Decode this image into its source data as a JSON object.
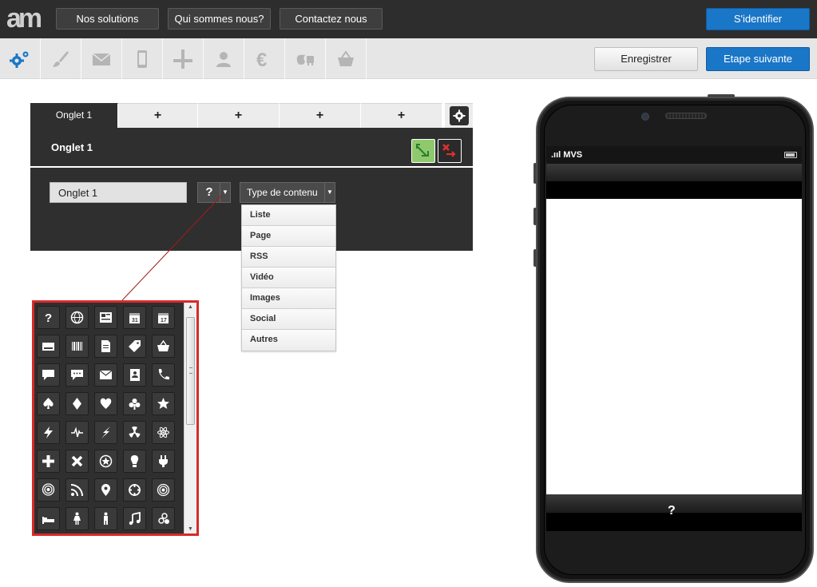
{
  "header": {
    "logo_text": "am",
    "nav": [
      "Nos solutions",
      "Qui sommes nous?",
      "Contactez nous"
    ],
    "login_label": "S'identifier"
  },
  "toolbar": {
    "tools": [
      "gears-icon",
      "brush-icon",
      "envelope-icon",
      "smartphone-icon",
      "layout-cross-icon",
      "user-icon",
      "euro-icon",
      "apple-android-icon",
      "basket-icon"
    ],
    "register_label": "Enregistrer",
    "next_label": "Etape suivante"
  },
  "editor": {
    "tabs": [
      "Onglet 1",
      "+",
      "+",
      "+",
      "+"
    ],
    "title": "Onglet 1",
    "name_value": "Onglet 1",
    "icon_picker_value": "?",
    "content_type_label": "Type de contenu",
    "content_types": [
      "Liste",
      "Page",
      "RSS",
      "Vidéo",
      "Images",
      "Social",
      "Autres"
    ]
  },
  "icon_grid": {
    "icons": [
      "question-icon",
      "globe-icon",
      "news-icon",
      "calendar-31-icon",
      "calendar-17-icon",
      "keyboard-icon",
      "barcode-icon",
      "document-icon",
      "tag-icon",
      "basket-icon",
      "speech-bubble-icon",
      "chat-dots-icon",
      "envelope-icon",
      "address-book-icon",
      "phone-icon",
      "spade-icon",
      "diamond-icon",
      "heart-icon",
      "club-icon",
      "star-icon",
      "lightning-icon",
      "pulse-icon",
      "bolt-icon",
      "radiation-icon",
      "atom-icon",
      "plus-icon",
      "cross-icon",
      "star-circle-icon",
      "bulb-icon",
      "plug-icon",
      "podcast-icon",
      "rss-icon",
      "location-pin-icon",
      "target-crosshair-icon",
      "bullseye-icon",
      "bed-icon",
      "woman-icon",
      "man-icon",
      "music-note-icon",
      "biohazard-icon"
    ]
  },
  "phone": {
    "carrier": "MVS",
    "tab_icon": "?"
  },
  "colors": {
    "accent": "#1a76c7",
    "dark": "#2f2f2f",
    "highlight": "#d72a2a"
  }
}
